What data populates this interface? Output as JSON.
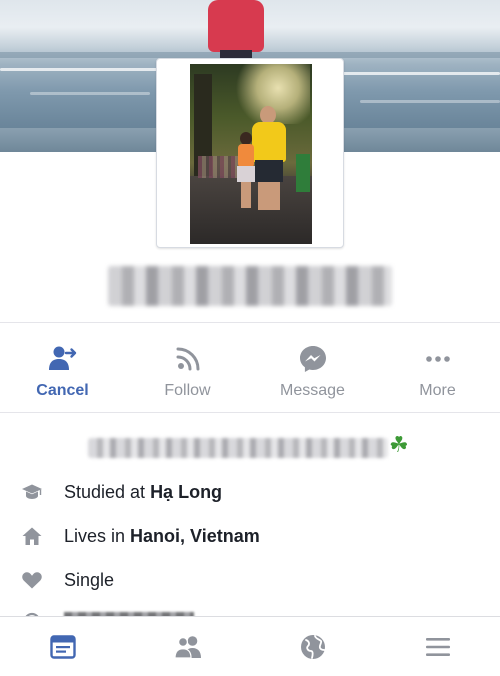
{
  "actions": [
    {
      "label": "Cancel",
      "icon": "unfollow-person-icon",
      "active": true
    },
    {
      "label": "Follow",
      "icon": "rss-follow-icon",
      "active": false
    },
    {
      "label": "Message",
      "icon": "messenger-icon",
      "active": false
    },
    {
      "label": "More",
      "icon": "more-dots-icon",
      "active": false
    }
  ],
  "bio": {
    "emoji": "☘"
  },
  "info": {
    "education": {
      "prefix": "Studied at ",
      "value": "Hạ Long",
      "icon": "graduation-cap-icon"
    },
    "residence": {
      "prefix": "Lives in ",
      "value": "Hanoi, Vietnam",
      "icon": "home-icon"
    },
    "relationship": {
      "text": "Single",
      "icon": "heart-icon"
    }
  },
  "bottom_nav": [
    {
      "name": "news-feed",
      "icon": "news-feed-icon",
      "active": true
    },
    {
      "name": "friends",
      "icon": "friends-icon",
      "active": false
    },
    {
      "name": "notifications",
      "icon": "globe-icon",
      "active": false
    },
    {
      "name": "menu",
      "icon": "hamburger-menu-icon",
      "active": false
    }
  ],
  "colors": {
    "accent": "#4267b2",
    "muted": "#90949c",
    "text": "#1d2129"
  }
}
